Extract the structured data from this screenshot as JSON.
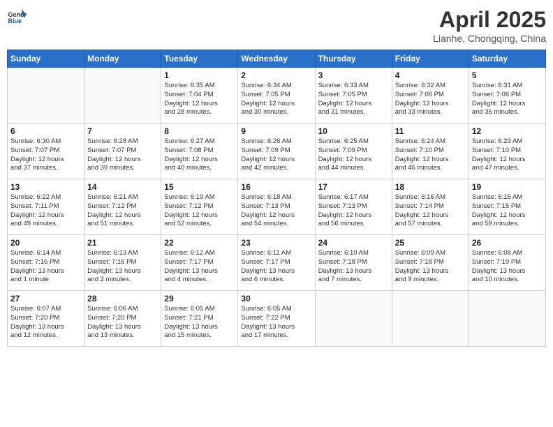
{
  "header": {
    "logo_line1": "General",
    "logo_line2": "Blue",
    "month": "April 2025",
    "location": "Lianhe, Chongqing, China"
  },
  "weekdays": [
    "Sunday",
    "Monday",
    "Tuesday",
    "Wednesday",
    "Thursday",
    "Friday",
    "Saturday"
  ],
  "weeks": [
    [
      {
        "day": "",
        "info": []
      },
      {
        "day": "",
        "info": []
      },
      {
        "day": "1",
        "info": [
          "Sunrise: 6:35 AM",
          "Sunset: 7:04 PM",
          "Daylight: 12 hours",
          "and 28 minutes."
        ]
      },
      {
        "day": "2",
        "info": [
          "Sunrise: 6:34 AM",
          "Sunset: 7:05 PM",
          "Daylight: 12 hours",
          "and 30 minutes."
        ]
      },
      {
        "day": "3",
        "info": [
          "Sunrise: 6:33 AM",
          "Sunset: 7:05 PM",
          "Daylight: 12 hours",
          "and 31 minutes."
        ]
      },
      {
        "day": "4",
        "info": [
          "Sunrise: 6:32 AM",
          "Sunset: 7:06 PM",
          "Daylight: 12 hours",
          "and 33 minutes."
        ]
      },
      {
        "day": "5",
        "info": [
          "Sunrise: 6:31 AM",
          "Sunset: 7:06 PM",
          "Daylight: 12 hours",
          "and 35 minutes."
        ]
      }
    ],
    [
      {
        "day": "6",
        "info": [
          "Sunrise: 6:30 AM",
          "Sunset: 7:07 PM",
          "Daylight: 12 hours",
          "and 37 minutes."
        ]
      },
      {
        "day": "7",
        "info": [
          "Sunrise: 6:28 AM",
          "Sunset: 7:07 PM",
          "Daylight: 12 hours",
          "and 39 minutes."
        ]
      },
      {
        "day": "8",
        "info": [
          "Sunrise: 6:27 AM",
          "Sunset: 7:08 PM",
          "Daylight: 12 hours",
          "and 40 minutes."
        ]
      },
      {
        "day": "9",
        "info": [
          "Sunrise: 6:26 AM",
          "Sunset: 7:09 PM",
          "Daylight: 12 hours",
          "and 42 minutes."
        ]
      },
      {
        "day": "10",
        "info": [
          "Sunrise: 6:25 AM",
          "Sunset: 7:09 PM",
          "Daylight: 12 hours",
          "and 44 minutes."
        ]
      },
      {
        "day": "11",
        "info": [
          "Sunrise: 6:24 AM",
          "Sunset: 7:10 PM",
          "Daylight: 12 hours",
          "and 45 minutes."
        ]
      },
      {
        "day": "12",
        "info": [
          "Sunrise: 6:23 AM",
          "Sunset: 7:10 PM",
          "Daylight: 12 hours",
          "and 47 minutes."
        ]
      }
    ],
    [
      {
        "day": "13",
        "info": [
          "Sunrise: 6:22 AM",
          "Sunset: 7:11 PM",
          "Daylight: 12 hours",
          "and 49 minutes."
        ]
      },
      {
        "day": "14",
        "info": [
          "Sunrise: 6:21 AM",
          "Sunset: 7:12 PM",
          "Daylight: 12 hours",
          "and 51 minutes."
        ]
      },
      {
        "day": "15",
        "info": [
          "Sunrise: 6:19 AM",
          "Sunset: 7:12 PM",
          "Daylight: 12 hours",
          "and 52 minutes."
        ]
      },
      {
        "day": "16",
        "info": [
          "Sunrise: 6:18 AM",
          "Sunset: 7:13 PM",
          "Daylight: 12 hours",
          "and 54 minutes."
        ]
      },
      {
        "day": "17",
        "info": [
          "Sunrise: 6:17 AM",
          "Sunset: 7:13 PM",
          "Daylight: 12 hours",
          "and 56 minutes."
        ]
      },
      {
        "day": "18",
        "info": [
          "Sunrise: 6:16 AM",
          "Sunset: 7:14 PM",
          "Daylight: 12 hours",
          "and 57 minutes."
        ]
      },
      {
        "day": "19",
        "info": [
          "Sunrise: 6:15 AM",
          "Sunset: 7:15 PM",
          "Daylight: 12 hours",
          "and 59 minutes."
        ]
      }
    ],
    [
      {
        "day": "20",
        "info": [
          "Sunrise: 6:14 AM",
          "Sunset: 7:15 PM",
          "Daylight: 13 hours",
          "and 1 minute."
        ]
      },
      {
        "day": "21",
        "info": [
          "Sunrise: 6:13 AM",
          "Sunset: 7:16 PM",
          "Daylight: 13 hours",
          "and 2 minutes."
        ]
      },
      {
        "day": "22",
        "info": [
          "Sunrise: 6:12 AM",
          "Sunset: 7:17 PM",
          "Daylight: 13 hours",
          "and 4 minutes."
        ]
      },
      {
        "day": "23",
        "info": [
          "Sunrise: 6:11 AM",
          "Sunset: 7:17 PM",
          "Daylight: 13 hours",
          "and 6 minutes."
        ]
      },
      {
        "day": "24",
        "info": [
          "Sunrise: 6:10 AM",
          "Sunset: 7:18 PM",
          "Daylight: 13 hours",
          "and 7 minutes."
        ]
      },
      {
        "day": "25",
        "info": [
          "Sunrise: 6:09 AM",
          "Sunset: 7:18 PM",
          "Daylight: 13 hours",
          "and 9 minutes."
        ]
      },
      {
        "day": "26",
        "info": [
          "Sunrise: 6:08 AM",
          "Sunset: 7:19 PM",
          "Daylight: 13 hours",
          "and 10 minutes."
        ]
      }
    ],
    [
      {
        "day": "27",
        "info": [
          "Sunrise: 6:07 AM",
          "Sunset: 7:20 PM",
          "Daylight: 13 hours",
          "and 12 minutes."
        ]
      },
      {
        "day": "28",
        "info": [
          "Sunrise: 6:06 AM",
          "Sunset: 7:20 PM",
          "Daylight: 13 hours",
          "and 13 minutes."
        ]
      },
      {
        "day": "29",
        "info": [
          "Sunrise: 6:05 AM",
          "Sunset: 7:21 PM",
          "Daylight: 13 hours",
          "and 15 minutes."
        ]
      },
      {
        "day": "30",
        "info": [
          "Sunrise: 6:05 AM",
          "Sunset: 7:22 PM",
          "Daylight: 13 hours",
          "and 17 minutes."
        ]
      },
      {
        "day": "",
        "info": []
      },
      {
        "day": "",
        "info": []
      },
      {
        "day": "",
        "info": []
      }
    ]
  ]
}
